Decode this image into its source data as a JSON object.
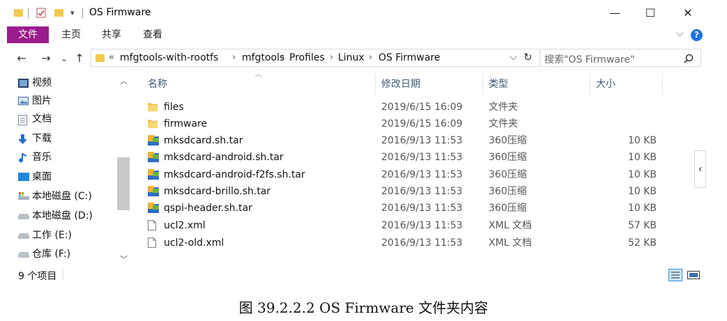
{
  "window": {
    "title": "OS Firmware"
  },
  "window_controls": {
    "minimize": "—",
    "maximize": "☐",
    "close": "✕"
  },
  "ribbon": {
    "tabs": [
      "文件",
      "主页",
      "共享",
      "查看"
    ],
    "file_tab_color": "#9b1c8c",
    "expand_glyph": "⌵",
    "help_glyph": "?"
  },
  "nav_buttons": {
    "back": "←",
    "forward": "→",
    "recent": "⌄",
    "up": "↑"
  },
  "address": {
    "overflow": "«",
    "crumbs": [
      "mfgtools-with-rootfs",
      "mfgtools",
      "Profiles",
      "Linux",
      "OS Firmware"
    ],
    "dropdown_glyph": "⌵",
    "refresh_glyph": "↻"
  },
  "search": {
    "placeholder": "搜索\"OS Firmware\"",
    "icon": "search-icon"
  },
  "nav_pane": [
    {
      "label": "视频",
      "icon": "video-icon"
    },
    {
      "label": "图片",
      "icon": "pictures-icon"
    },
    {
      "label": "文档",
      "icon": "documents-icon"
    },
    {
      "label": "下载",
      "icon": "download-icon"
    },
    {
      "label": "音乐",
      "icon": "music-icon"
    },
    {
      "label": "桌面",
      "icon": "desktop-icon"
    },
    {
      "label": "本地磁盘 (C:)",
      "icon": "drive-c-icon"
    },
    {
      "label": "本地磁盘 (D:)",
      "icon": "drive-icon"
    },
    {
      "label": "工作 (E:)",
      "icon": "drive-icon"
    },
    {
      "label": "仓库 (F:)",
      "icon": "drive-icon"
    }
  ],
  "columns": {
    "name": "名称",
    "date": "修改日期",
    "type": "类型",
    "size": "大小"
  },
  "files": [
    {
      "name": "files",
      "date": "2019/6/15 16:09",
      "type": "文件夹",
      "size": "",
      "icon": "folder-icon"
    },
    {
      "name": "firmware",
      "date": "2019/6/15 16:09",
      "type": "文件夹",
      "size": "",
      "icon": "folder-icon"
    },
    {
      "name": "mksdcard.sh.tar",
      "date": "2016/9/13 11:53",
      "type": "360压缩",
      "size": "10 KB",
      "icon": "archive-icon"
    },
    {
      "name": "mksdcard-android.sh.tar",
      "date": "2016/9/13 11:53",
      "type": "360压缩",
      "size": "10 KB",
      "icon": "archive-icon"
    },
    {
      "name": "mksdcard-android-f2fs.sh.tar",
      "date": "2016/9/13 11:53",
      "type": "360压缩",
      "size": "10 KB",
      "icon": "archive-icon"
    },
    {
      "name": "mksdcard-brillo.sh.tar",
      "date": "2016/9/13 11:53",
      "type": "360压缩",
      "size": "10 KB",
      "icon": "archive-icon"
    },
    {
      "name": "qspi-header.sh.tar",
      "date": "2016/9/13 11:53",
      "type": "360压缩",
      "size": "10 KB",
      "icon": "archive-icon"
    },
    {
      "name": "ucl2.xml",
      "date": "2016/9/13 11:53",
      "type": "XML 文档",
      "size": "57 KB",
      "icon": "xml-file-icon"
    },
    {
      "name": "ucl2-old.xml",
      "date": "2016/9/13 11:53",
      "type": "XML 文档",
      "size": "52 KB",
      "icon": "xml-file-icon"
    }
  ],
  "status_bar": {
    "item_count": "9 个项目"
  },
  "preview_toggle": "‹",
  "caption": "图 39.2.2.2 OS Firmware 文件夹内容"
}
